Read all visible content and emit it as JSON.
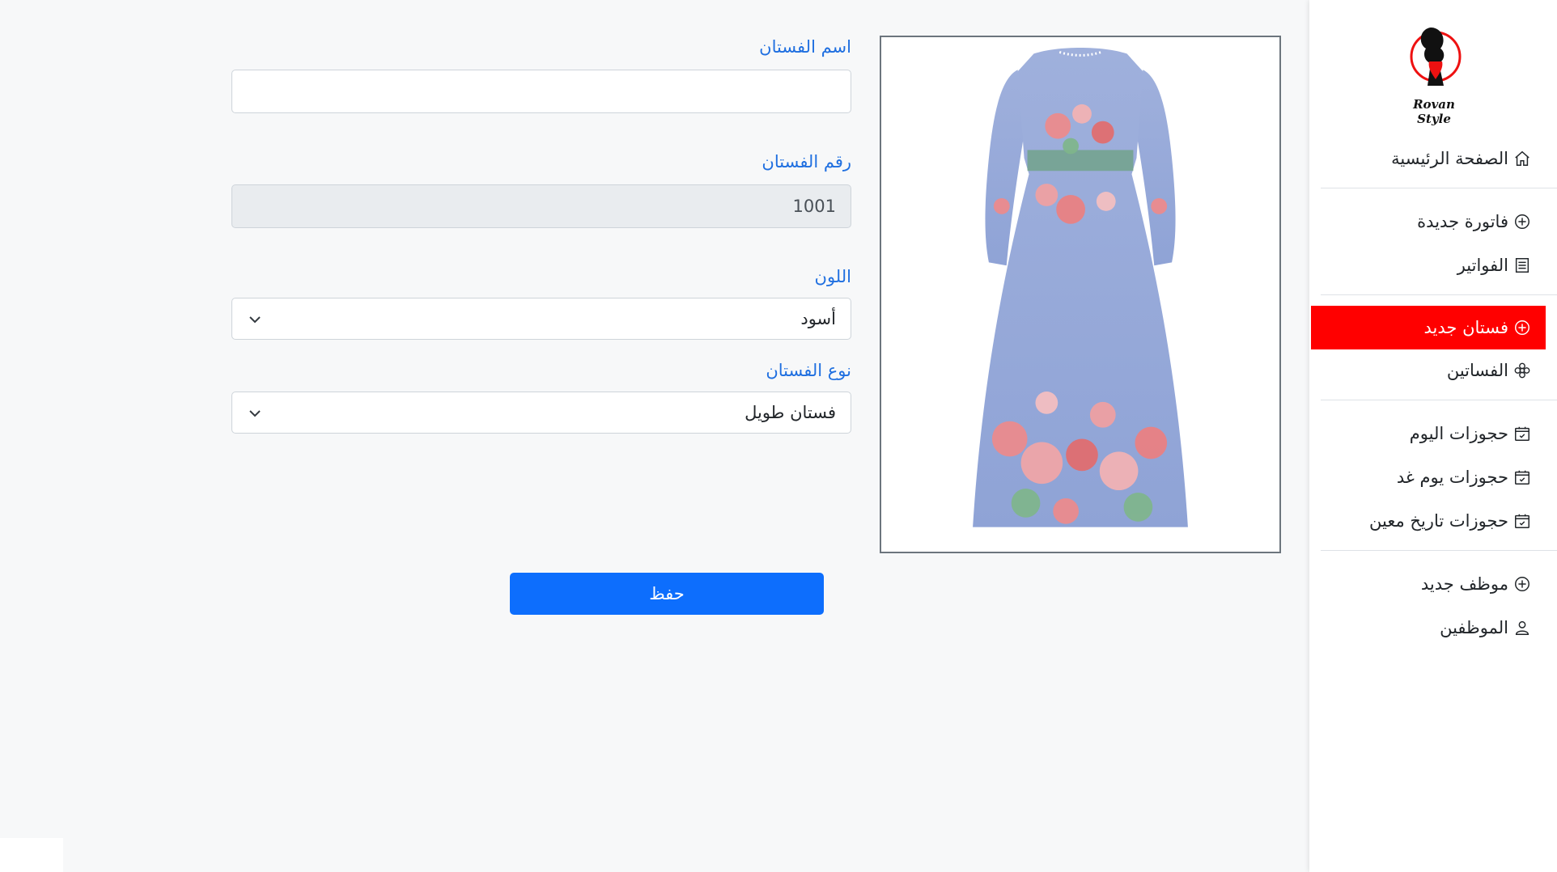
{
  "brand": {
    "logo_text": "Rovan Style"
  },
  "sidebar": {
    "items": [
      {
        "label": "الصفحة الرئيسية",
        "icon": "home-icon"
      },
      {
        "label": "فاتورة جديدة",
        "icon": "plus-circle-icon"
      },
      {
        "label": "الفواتير",
        "icon": "receipt-icon"
      },
      {
        "label": "فستان جديد",
        "icon": "plus-circle-icon",
        "active": true
      },
      {
        "label": "الفساتين",
        "icon": "flower-icon"
      },
      {
        "label": "حجوزات اليوم",
        "icon": "calendar-check-icon"
      },
      {
        "label": "حجوزات يوم غد",
        "icon": "calendar-check-icon"
      },
      {
        "label": "حجوزات تاريخ معين",
        "icon": "calendar-check-icon"
      },
      {
        "label": "موظف جديد",
        "icon": "plus-circle-icon"
      },
      {
        "label": "الموظفين",
        "icon": "person-icon"
      }
    ],
    "active_color": "#ff0000"
  },
  "form": {
    "name_label": "اسم الفستان",
    "name_value": "",
    "number_label": "رقم الفستان",
    "number_value": "1001",
    "color_label": "اللون",
    "color_value": "أسود",
    "type_label": "نوع الفستان",
    "type_value": "فستان طويل",
    "save_label": "حفظ"
  },
  "colors": {
    "label_blue": "#1f6fe0",
    "primary": "#0d6efd"
  }
}
